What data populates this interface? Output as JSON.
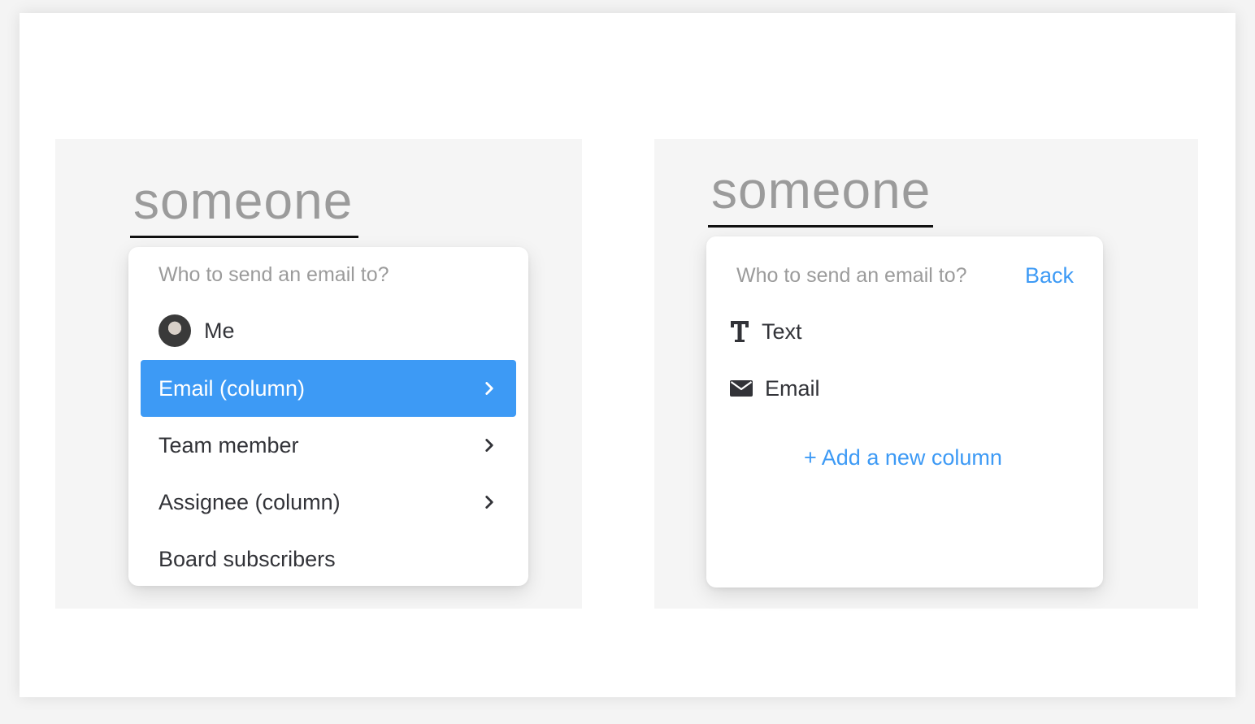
{
  "left_panel": {
    "token": "someone",
    "dropdown": {
      "prompt": "Who to send an email to?",
      "items": [
        {
          "label": "Me",
          "icon": "avatar",
          "has_submenu": false,
          "active": false
        },
        {
          "label": "Email (column)",
          "icon": "chevron-right-icon",
          "has_submenu": true,
          "active": true
        },
        {
          "label": "Team member",
          "icon": "chevron-right-icon",
          "has_submenu": true,
          "active": false
        },
        {
          "label": "Assignee (column)",
          "icon": "chevron-right-icon",
          "has_submenu": true,
          "active": false
        },
        {
          "label": "Board subscribers",
          "has_submenu": false,
          "active": false
        }
      ]
    }
  },
  "right_panel": {
    "token": "someone",
    "dropdown": {
      "prompt": "Who to send an email to?",
      "back_label": "Back",
      "items": [
        {
          "label": "Text",
          "icon": "text-type-icon"
        },
        {
          "label": "Email",
          "icon": "envelope-icon"
        }
      ],
      "add_column_label": "+ Add a new column"
    }
  },
  "colors": {
    "accent": "#3d9af5",
    "text_primary": "#323338",
    "text_muted": "#9b9b9b",
    "panel_bg": "#f5f5f5"
  }
}
